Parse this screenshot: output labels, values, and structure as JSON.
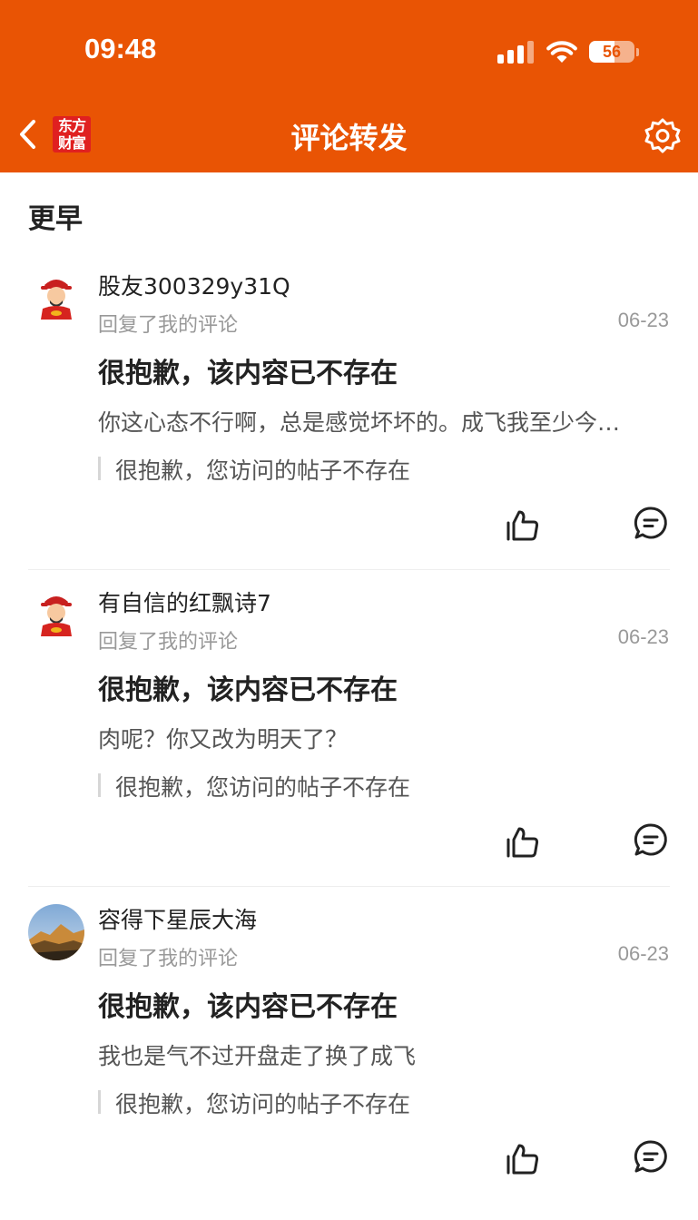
{
  "status_bar": {
    "time": "09:48",
    "battery": "56",
    "battery_level": 0.56,
    "icons": [
      "signal-icon",
      "wifi-icon",
      "battery-icon"
    ]
  },
  "nav": {
    "back_icon": "chevron-left-icon",
    "logo_line1": "东方",
    "logo_line2": "财富",
    "title": "评论转发",
    "settings_icon": "gear-icon"
  },
  "section": {
    "title": "更早"
  },
  "items": [
    {
      "username": "股友300329y31Q",
      "reply_label": "回复了我的评论",
      "date": "06-23",
      "headline": "很抱歉，该内容已不存在",
      "content": "你这心态不行啊，总是感觉坏坏的。成飞我至少今…",
      "quote": "很抱歉，您访问的帖子不存在",
      "avatar": "caishen-avatar"
    },
    {
      "username": "有自信的红飘诗7",
      "reply_label": "回复了我的评论",
      "date": "06-23",
      "headline": "很抱歉，该内容已不存在",
      "content": "肉呢？你又改为明天了？",
      "quote": "很抱歉，您访问的帖子不存在",
      "avatar": "caishen-avatar"
    },
    {
      "username": "容得下星辰大海",
      "reply_label": "回复了我的评论",
      "date": "06-23",
      "headline": "很抱歉，该内容已不存在",
      "content": "我也是气不过开盘走了换了成飞",
      "quote": "很抱歉，您访问的帖子不存在",
      "avatar": "landscape-avatar"
    }
  ],
  "colors": {
    "brand": "#e95404",
    "logo_red": "#e02020",
    "text_primary": "#222222",
    "text_secondary": "#555555",
    "text_muted": "#999999"
  }
}
